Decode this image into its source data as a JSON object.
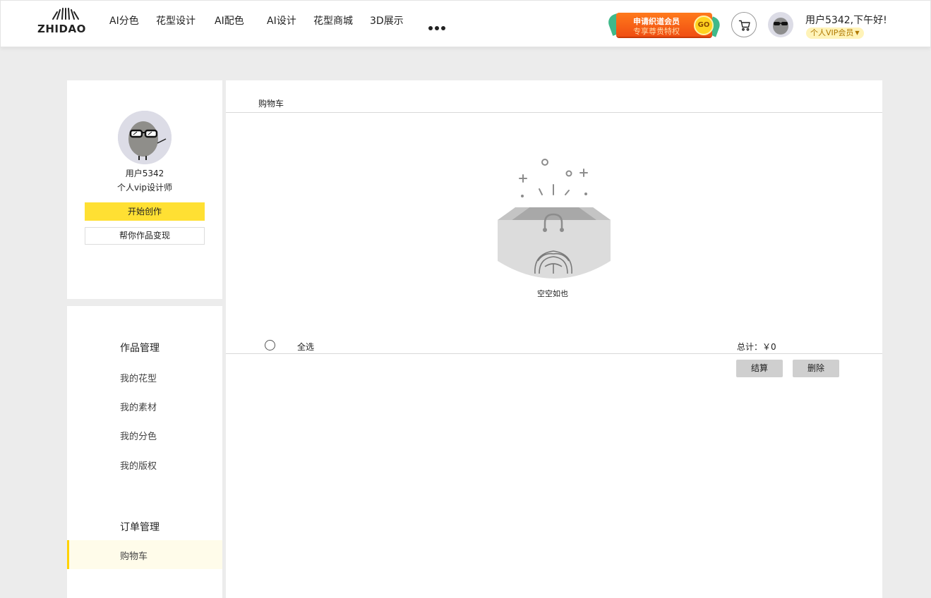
{
  "header": {
    "logo_text": "ZHIDAO",
    "nav": [
      {
        "label": "AI分色"
      },
      {
        "label": "花型设计"
      },
      {
        "label": "AI配色"
      },
      {
        "label": "AI设计"
      },
      {
        "label": "花型商城"
      },
      {
        "label": "3D展示"
      }
    ],
    "more_icon": "more-dots-icon",
    "vip_banner": {
      "line1": "申请织道会员",
      "line2": "专享尊贵特权",
      "go": "GO"
    },
    "cart_icon": "cart-icon",
    "greeting": "用户5342,下午好!",
    "vip_tag": "个人VIP会员"
  },
  "profile": {
    "name": "用户5342",
    "role": "个人vip设计师",
    "create_button": "开始创作",
    "monetize_button": "帮你作品变现"
  },
  "menu": {
    "works_heading": "作品管理",
    "works_items": [
      "我的花型",
      "我的素材",
      "我的分色",
      "我的版权"
    ],
    "orders_heading": "订单管理",
    "active_item": "购物车"
  },
  "main": {
    "title": "购物车",
    "empty_text": "空空如也",
    "select_all": "全选",
    "total": "总计：￥0",
    "checkout_button": "结算",
    "delete_button": "删除"
  },
  "colors": {
    "accent_yellow": "#ffe033",
    "vip_orange": "#f04e12",
    "page_bg": "#ececec"
  }
}
